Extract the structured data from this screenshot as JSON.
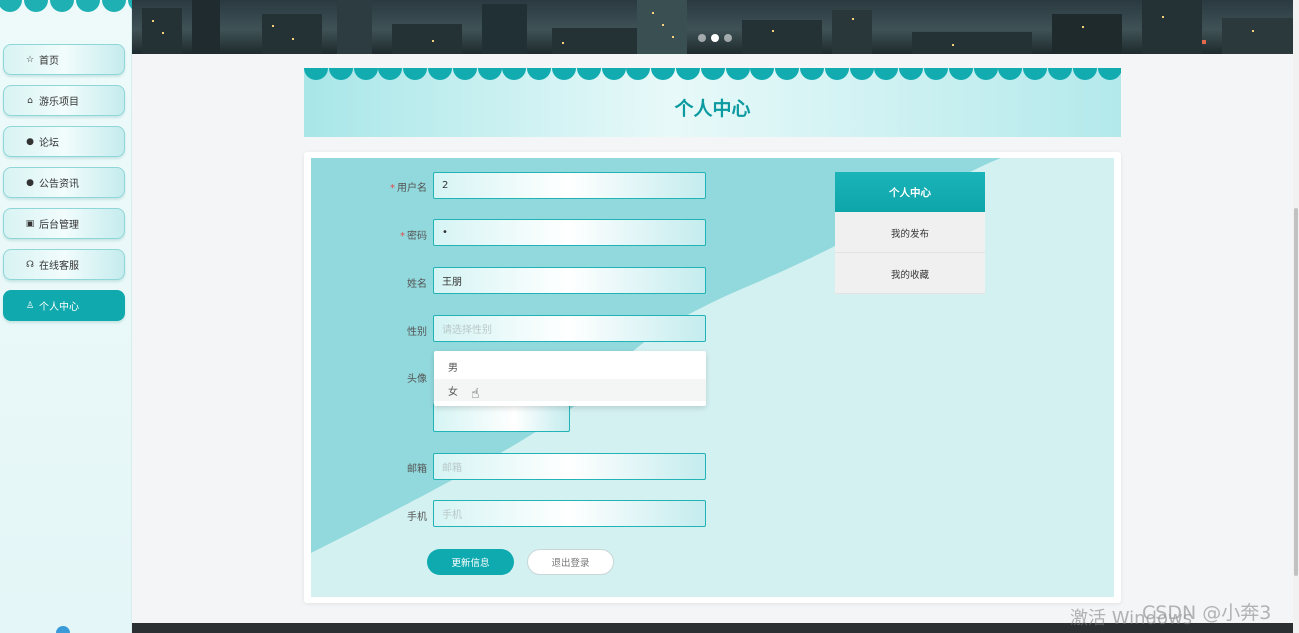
{
  "sidebar": {
    "items": [
      {
        "label": "首页",
        "icon": "star-icon",
        "glyph": "☆"
      },
      {
        "label": "游乐项目",
        "icon": "lock-icon",
        "glyph": "⌂"
      },
      {
        "label": "论坛",
        "icon": "info-icon",
        "glyph": "●"
      },
      {
        "label": "公告资讯",
        "icon": "question-icon",
        "glyph": "●"
      },
      {
        "label": "后台管理",
        "icon": "briefcase-icon",
        "glyph": "▣"
      },
      {
        "label": "在线客服",
        "icon": "headset-icon",
        "glyph": "☊"
      },
      {
        "label": "个人中心",
        "icon": "user-icon",
        "glyph": "♙"
      }
    ],
    "active_index": 6
  },
  "page": {
    "title": "个人中心"
  },
  "form": {
    "username_label": "用户名",
    "username_value": "2",
    "password_label": "密码",
    "password_value": "•",
    "name_label": "姓名",
    "name_value": "王朋",
    "gender_label": "性别",
    "gender_placeholder": "请选择性别",
    "avatar_label": "头像",
    "email_label": "邮箱",
    "email_placeholder": "邮箱",
    "phone_label": "手机",
    "phone_placeholder": "手机",
    "required_mark": "*",
    "gender_options": [
      "男",
      "女"
    ],
    "hovered_option_index": 1
  },
  "buttons": {
    "update": "更新信息",
    "logout": "退出登录"
  },
  "side_menu": {
    "title": "个人中心",
    "items": [
      "我的发布",
      "我的收藏"
    ]
  },
  "watermarks": {
    "activate": "激活 Windows",
    "csdn": "CSDN @小奔3"
  },
  "colors": {
    "accent": "#0eaab0",
    "required": "#e04b4b"
  }
}
